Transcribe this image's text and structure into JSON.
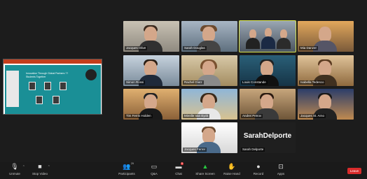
{
  "shared_screen": {
    "slide_title": "Innovation Through Global Partners ?? Students Together",
    "icon": "presentation-slide"
  },
  "participants": [
    {
      "name": "Jacques Olive"
    },
    {
      "name": "Sarah Douglas"
    },
    {
      "name": ""
    },
    {
      "name": "Mia Danzer"
    },
    {
      "name": "Simon Rossi"
    },
    {
      "name": "Rachel Glutz"
    },
    {
      "name": "Louis Constande"
    },
    {
      "name": "Isabella Tedesco"
    },
    {
      "name": "Tim Ferris Holden"
    },
    {
      "name": "Mireille Van Eyck"
    },
    {
      "name": "Andrei Petrov"
    },
    {
      "name": "Jacques St. Arno"
    },
    {
      "name": "Jacques Ferrer"
    },
    {
      "name": "Sarah Delporte",
      "display": "SarahDelporte"
    }
  ],
  "toolbar": {
    "unmute": "Unmute",
    "stop_video": "Stop Video",
    "participants": "Participants",
    "participants_count": "29",
    "chat_badge": "5",
    "qa": "Q&A",
    "chat": "Chat",
    "share_screen": "Share Screen",
    "raise_hand": "Raise Hand",
    "record": "Record",
    "apps": "Apps",
    "leave": "Leave"
  },
  "colors": {
    "active_speaker": "#d9e44c",
    "leave": "#d92b2b",
    "share": "#28c840"
  }
}
